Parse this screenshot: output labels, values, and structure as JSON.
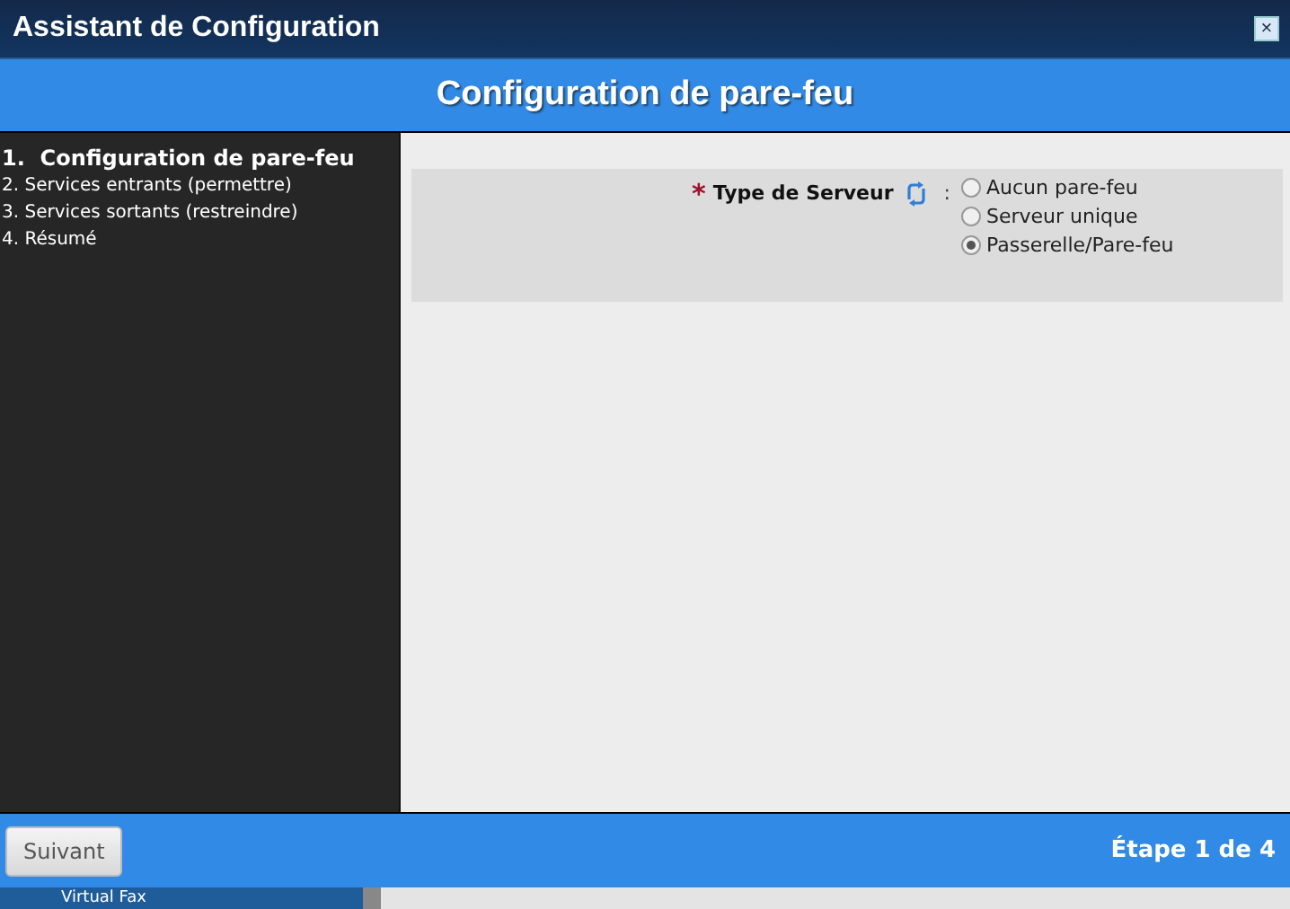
{
  "window": {
    "title": "Assistant de Configuration",
    "close": "×"
  },
  "header": {
    "title": "Configuration de pare-feu"
  },
  "steps": [
    {
      "label": "1.  Configuration de pare-feu",
      "selected": true
    },
    {
      "label": "2. Services entrants (permettre)",
      "selected": false
    },
    {
      "label": "3. Services sortants (restreindre)",
      "selected": false
    },
    {
      "label": "4. Résumé",
      "selected": false
    }
  ],
  "form": {
    "required_mark": "*",
    "label": "Type de Serveur",
    "colon": ":",
    "options": [
      {
        "label": "Aucun pare-feu",
        "selected": false
      },
      {
        "label": "Serveur unique",
        "selected": false
      },
      {
        "label": "Passerelle/Pare-feu",
        "selected": true
      }
    ]
  },
  "footer": {
    "next_button": "Suivant",
    "step_text": "Étape 1 de 4"
  },
  "background": {
    "item": "Virtual Fax"
  }
}
